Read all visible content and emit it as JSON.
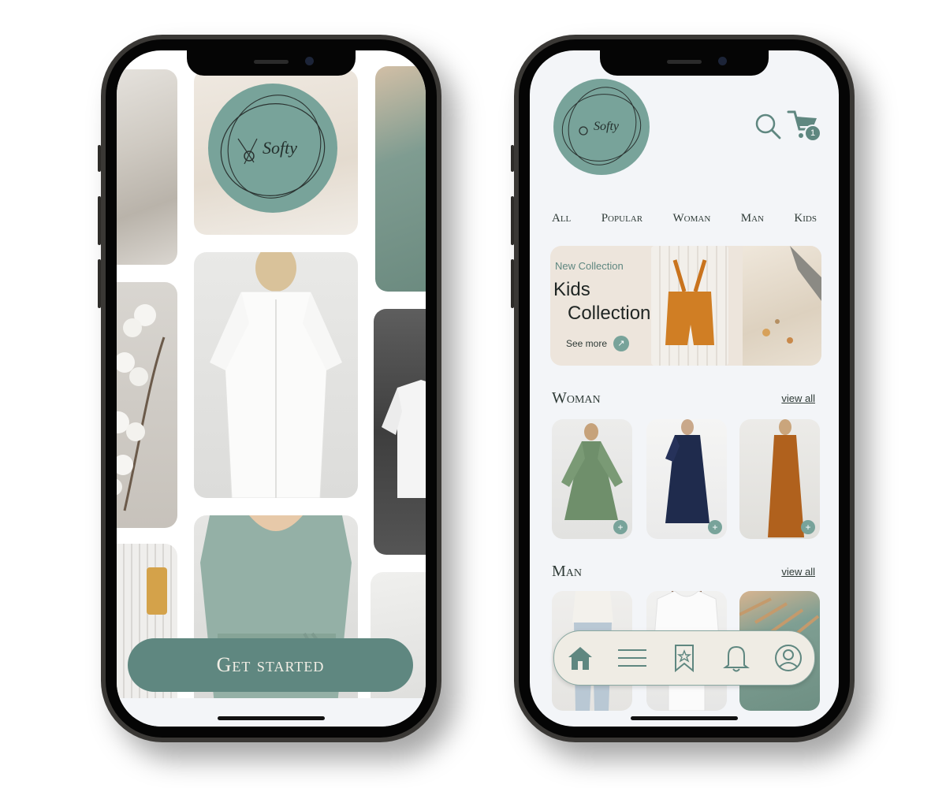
{
  "colors": {
    "sage": "#78a39a",
    "sage_dark": "#5f8780",
    "text_dark": "#2e3a36",
    "banner_bg": "#ede5dc",
    "screen_bg": "#f3f5f8"
  },
  "left_screen": {
    "logo_text": "Softy",
    "cta_label": "Get started"
  },
  "right_screen": {
    "logo_text": "Softy",
    "header_icons": [
      "search-icon",
      "cart-icon"
    ],
    "cart_badge": "1",
    "tabs": [
      "All",
      "Popular",
      "Woman",
      "Man",
      "Kids"
    ],
    "banner": {
      "eyebrow": "New Collection",
      "title_line1": "Kids",
      "title_line2": "Collection",
      "cta": "See more"
    },
    "sections": {
      "woman": {
        "title": "Woman",
        "link": "view all",
        "add_label": "+"
      },
      "man": {
        "title": "Man",
        "link": "view all"
      }
    },
    "nav_icons": [
      "home-icon",
      "menu-icon",
      "bookmark-star-icon",
      "bell-icon",
      "profile-icon"
    ]
  }
}
